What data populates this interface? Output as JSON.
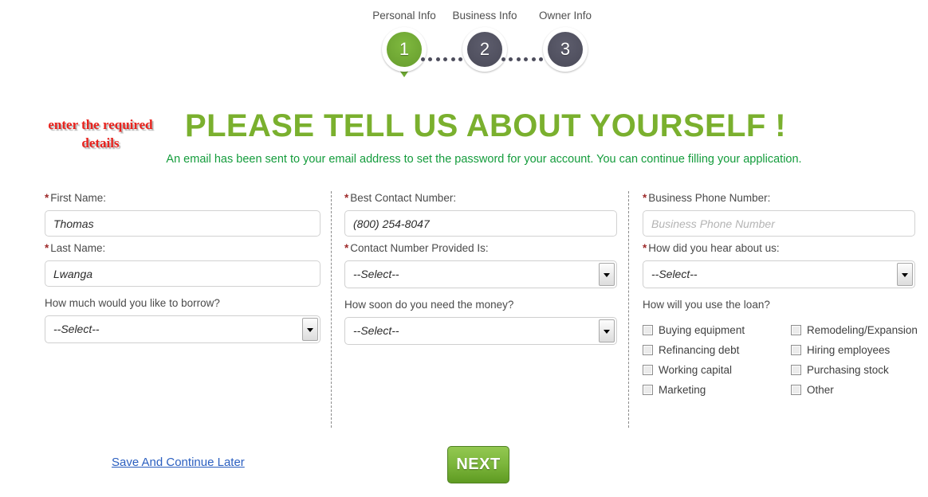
{
  "stepper": {
    "steps": [
      {
        "label": "Personal Info",
        "number": "1",
        "state": "active"
      },
      {
        "label": "Business Info",
        "number": "2",
        "state": "inactive"
      },
      {
        "label": "Owner Info",
        "number": "3",
        "state": "inactive"
      }
    ],
    "active_color": "#6faa33",
    "inactive_color": "#535362"
  },
  "annotation": {
    "text": "enter the required details",
    "color": "#e8231e"
  },
  "header": {
    "title": "PLEASE TELL US ABOUT YOURSELF !",
    "title_color": "#7ab02e",
    "subtitle": "An email has been sent to your email address to set the password for your account. You can continue filling your application.",
    "subtitle_color": "#149c3c"
  },
  "form": {
    "column1": {
      "first_name": {
        "label": "First Name:",
        "required": "*",
        "value": "Thomas",
        "placeholder": "First Name"
      },
      "last_name": {
        "label": "Last Name:",
        "required": "*",
        "value": "Lwanga",
        "placeholder": "Last Name"
      },
      "borrow_amount": {
        "label": "How much would you like to borrow?",
        "value": "--Select--"
      }
    },
    "column2": {
      "best_contact_number": {
        "label": "Best Contact Number:",
        "required": "*",
        "value": "(800) 254-8047",
        "placeholder": "Best Contact Number"
      },
      "contact_number_type": {
        "label": "Contact Number Provided Is:",
        "required": "*",
        "value": "--Select--"
      },
      "money_needed_by": {
        "label": "How soon do you need the money?",
        "value": "--Select--"
      }
    },
    "column3": {
      "business_phone": {
        "label": "Business Phone Number:",
        "required": "*",
        "value": "",
        "placeholder": "Business Phone Number"
      },
      "hear_about_us": {
        "label": "How did you hear about us:",
        "required": "*",
        "value": "--Select--"
      },
      "loan_use": {
        "label": "How will you use the loan?",
        "options_left": [
          {
            "label": "Buying equipment",
            "checked": false
          },
          {
            "label": "Refinancing debt",
            "checked": false
          },
          {
            "label": "Working capital",
            "checked": false
          },
          {
            "label": "Marketing",
            "checked": false
          }
        ],
        "options_right": [
          {
            "label": "Remodeling/Expansion",
            "checked": false
          },
          {
            "label": "Hiring employees",
            "checked": false
          },
          {
            "label": "Purchasing stock",
            "checked": false
          },
          {
            "label": "Other",
            "checked": false
          }
        ]
      }
    }
  },
  "footer": {
    "save_link": "Save And Continue Later",
    "next_button": "NEXT"
  }
}
